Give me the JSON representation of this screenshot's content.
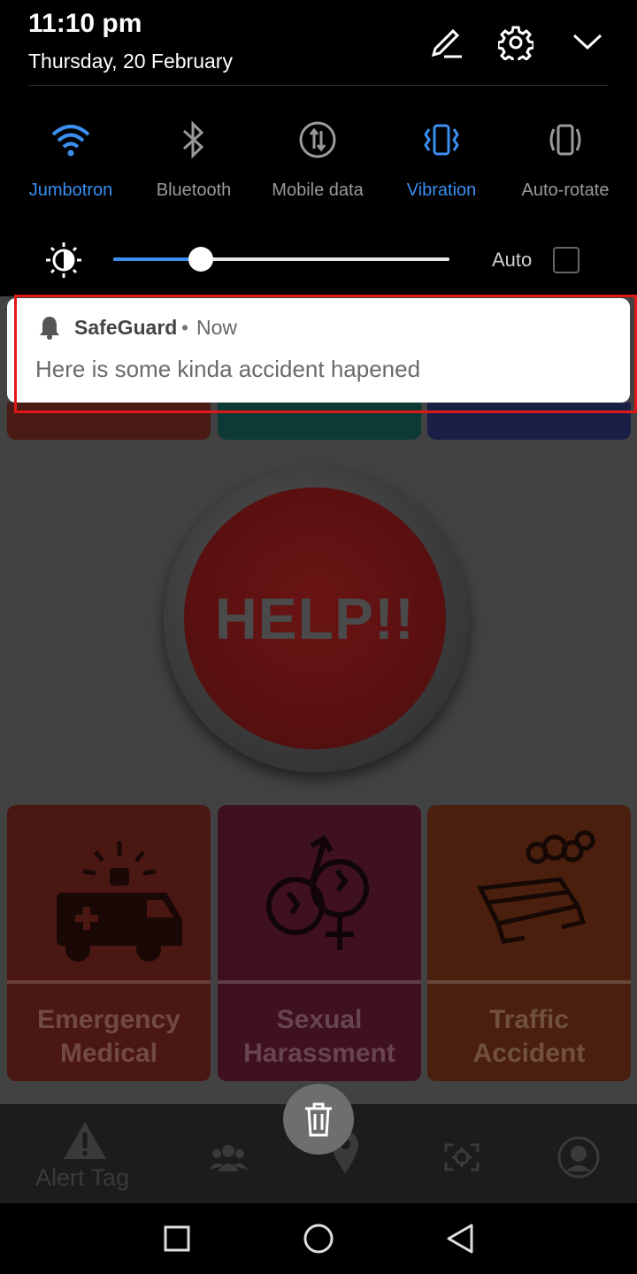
{
  "status": {
    "time": "11:10 pm",
    "date": "Thursday, 20 February"
  },
  "header_icons": [
    "edit-icon",
    "settings-icon",
    "collapse-chevron-icon"
  ],
  "quick_settings": [
    {
      "label": "Jumbotron",
      "icon": "wifi-icon",
      "active": true
    },
    {
      "label": "Bluetooth",
      "icon": "bluetooth-icon",
      "active": false
    },
    {
      "label": "Mobile data",
      "icon": "mobile-data-icon",
      "active": false
    },
    {
      "label": "Vibration",
      "icon": "vibration-icon",
      "active": true
    },
    {
      "label": "Auto-rotate",
      "icon": "auto-rotate-icon",
      "active": false
    }
  ],
  "brightness": {
    "level": 0.26,
    "auto_label": "Auto",
    "auto_checked": false
  },
  "notification": {
    "app": "SafeGuard",
    "separator": "•",
    "when": "Now",
    "message": "Here is some kinda accident hapened"
  },
  "app": {
    "help_label": "HELP!!",
    "categories": [
      {
        "line1": "Emergency",
        "line2": "Medical",
        "icon": "ambulance-icon",
        "color": "#4a1712"
      },
      {
        "line1": "Sexual",
        "line2": "Harassment",
        "icon": "gender-icon",
        "color": "#3e1020"
      },
      {
        "line1": "Traffic",
        "line2": "Accident",
        "icon": "car-crash-icon",
        "color": "#4a1f0e"
      }
    ],
    "nav": {
      "alert_tag_label": "Alert Tag"
    }
  },
  "colors": {
    "accent": "#3a8ff0",
    "highlight": "#e01818"
  }
}
